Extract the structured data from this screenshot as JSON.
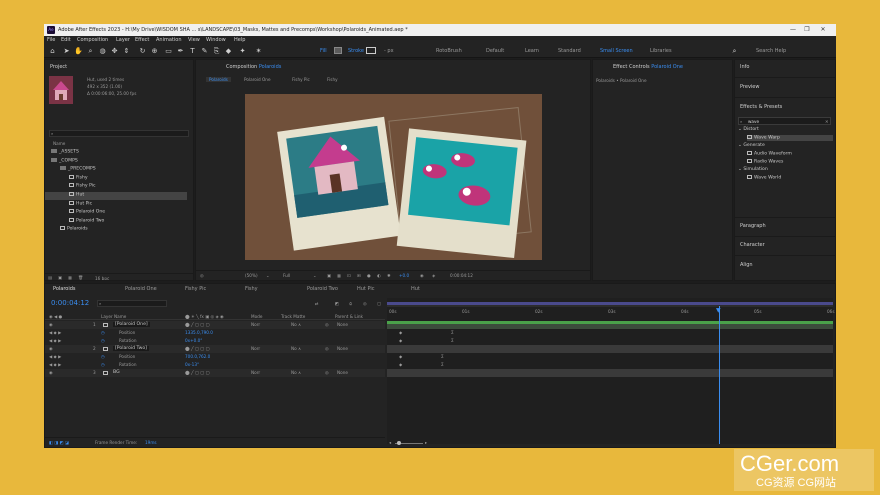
{
  "window": {
    "title": "Adobe After Effects 2023 - H:\\My Drive\\WISDOM SHA ... s\\LANDSCAPE\\03_Masks, Mattes and Precomps\\Workshop\\Polaroids_Animated.aep *",
    "controls": [
      "—",
      "❐",
      "✕"
    ]
  },
  "menu": [
    "File",
    "Edit",
    "Composition",
    "Layer",
    "Effect",
    "Animation",
    "View",
    "Window",
    "Help"
  ],
  "toolbar": {
    "fill": "Fill",
    "stroke": "Stroke",
    "px": "- px",
    "roto": "RotoBrush",
    "workspaces": [
      "Default",
      "Learn",
      "Standard",
      "Small Screen",
      "Libraries"
    ],
    "active_workspace": "Small Screen",
    "search": "Search Help"
  },
  "project": {
    "title": "Project",
    "thumb_name": "Hut",
    "thumb_used": ", used 2 times",
    "thumb_size": "492 x 352 (1.00)",
    "thumb_dur": "Δ 0:00:06:00, 25.00 fps",
    "col_name": "Name",
    "items": [
      {
        "label": "_ASSETS",
        "type": "folder",
        "indent": 0
      },
      {
        "label": "_COMPS",
        "type": "folder",
        "indent": 0
      },
      {
        "label": "_PRECOMPS",
        "type": "folder",
        "indent": 1
      },
      {
        "label": "Fishy",
        "type": "comp",
        "indent": 2
      },
      {
        "label": "Fishy Pic",
        "type": "comp",
        "indent": 2
      },
      {
        "label": "Hut",
        "type": "comp",
        "indent": 2,
        "selected": true
      },
      {
        "label": "Hut Pic",
        "type": "comp",
        "indent": 2
      },
      {
        "label": "Polaroid One",
        "type": "comp",
        "indent": 2
      },
      {
        "label": "Polaroid Two",
        "type": "comp",
        "indent": 2
      },
      {
        "label": "Polaroids",
        "type": "comp",
        "indent": 1
      }
    ],
    "bpc": "16 bpc"
  },
  "composition": {
    "title": "Composition",
    "name": "Polaroids",
    "crumbs": [
      "Polaroids",
      "Polaroid One",
      "Fishy Pic",
      "Fishy"
    ],
    "zoom": "(50%)",
    "res": "Full",
    "exposure": "+0.0",
    "time": "0:00:04:12"
  },
  "effect_controls": {
    "title": "Effect Controls",
    "name": "Polaroid One",
    "sub": "Polaroids • Polaroid One"
  },
  "right": {
    "info": "Info",
    "preview": "Preview",
    "effects": "Effects & Presets",
    "search": "wave",
    "groups": [
      {
        "label": "Distort",
        "items": [
          "Wave Warp"
        ]
      },
      {
        "label": "Generate",
        "items": [
          "Audio Waveform",
          "Radio Waves"
        ]
      },
      {
        "label": "Simulation",
        "items": [
          "Wave World"
        ]
      }
    ],
    "paragraph": "Paragraph",
    "character": "Character",
    "align": "Align"
  },
  "timeline": {
    "tabs": [
      "Polaroids",
      "Polaroid One",
      "Fishy Pic",
      "Fishy",
      "Polaroid Two",
      "Hut Pic",
      "Hut"
    ],
    "time": "0:00:04:12",
    "cols": {
      "layer_name": "Layer Name",
      "mode": "Mode",
      "trkmat": "Track Matte",
      "parent": "Parent & Link"
    },
    "layers": [
      {
        "num": "1",
        "name": "[Polaroid One]",
        "mode": "Norr",
        "trk": "No ∧",
        "parent": "None",
        "props": [
          {
            "name": "Position",
            "value": "1335.0,790.0"
          },
          {
            "name": "Rotation",
            "value": "0x+0.0°"
          }
        ]
      },
      {
        "num": "2",
        "name": "[Polaroid Two]",
        "mode": "Norr",
        "trk": "No ∧",
        "parent": "None",
        "props": [
          {
            "name": "Position",
            "value": "700.0,762.0"
          },
          {
            "name": "Rotation",
            "value": "0x-13°"
          }
        ]
      },
      {
        "num": "3",
        "name": "BG",
        "mode": "Norr",
        "trk": "No ∧",
        "parent": "None",
        "props": []
      }
    ],
    "ruler": [
      "00s",
      "01s",
      "02s",
      "03s",
      "04s",
      "05s",
      "06s"
    ],
    "render_label": "Frame Render Time:",
    "render_value": "19ms",
    "playhead_fraction": 0.745
  },
  "watermark": {
    "line1": "CGer.com",
    "line2": "CG资源 CG网站"
  }
}
